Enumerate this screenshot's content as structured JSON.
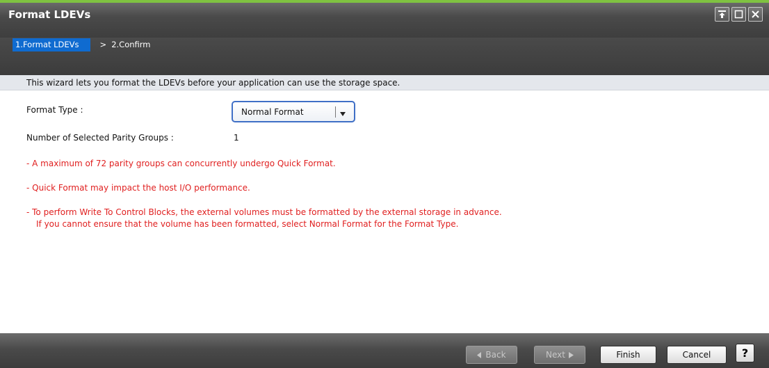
{
  "window": {
    "title": "Format LDEVs",
    "controls": [
      "pin-icon",
      "maximize-icon",
      "close-icon"
    ]
  },
  "wizard": {
    "steps": [
      {
        "label": "1.Format LDEVs",
        "active": true
      },
      {
        "label": "2.Confirm",
        "active": false
      }
    ],
    "separator": ">",
    "description": "This wizard lets you format the LDEVs before your application can use the storage space."
  },
  "form": {
    "format_type_label": "Format Type :",
    "format_type_value": "Normal Format",
    "parity_groups_label": "Number of Selected Parity Groups :",
    "parity_groups_value": "1"
  },
  "warnings": [
    "- A maximum of 72 parity groups can concurrently undergo Quick Format.",
    "- Quick Format may impact the host I/O performance.",
    "- To perform Write To Control Blocks, the external volumes must be formatted by the external storage in advance.",
    "If you cannot ensure that the volume has been formatted, select Normal Format for the Format Type."
  ],
  "footer": {
    "back_label": "Back",
    "next_label": "Next",
    "finish_label": "Finish",
    "cancel_label": "Cancel",
    "help_label": "?"
  },
  "colors": {
    "accent": "#0f6bd0",
    "warning": "#e02020",
    "top_strip": "#7fc241"
  }
}
